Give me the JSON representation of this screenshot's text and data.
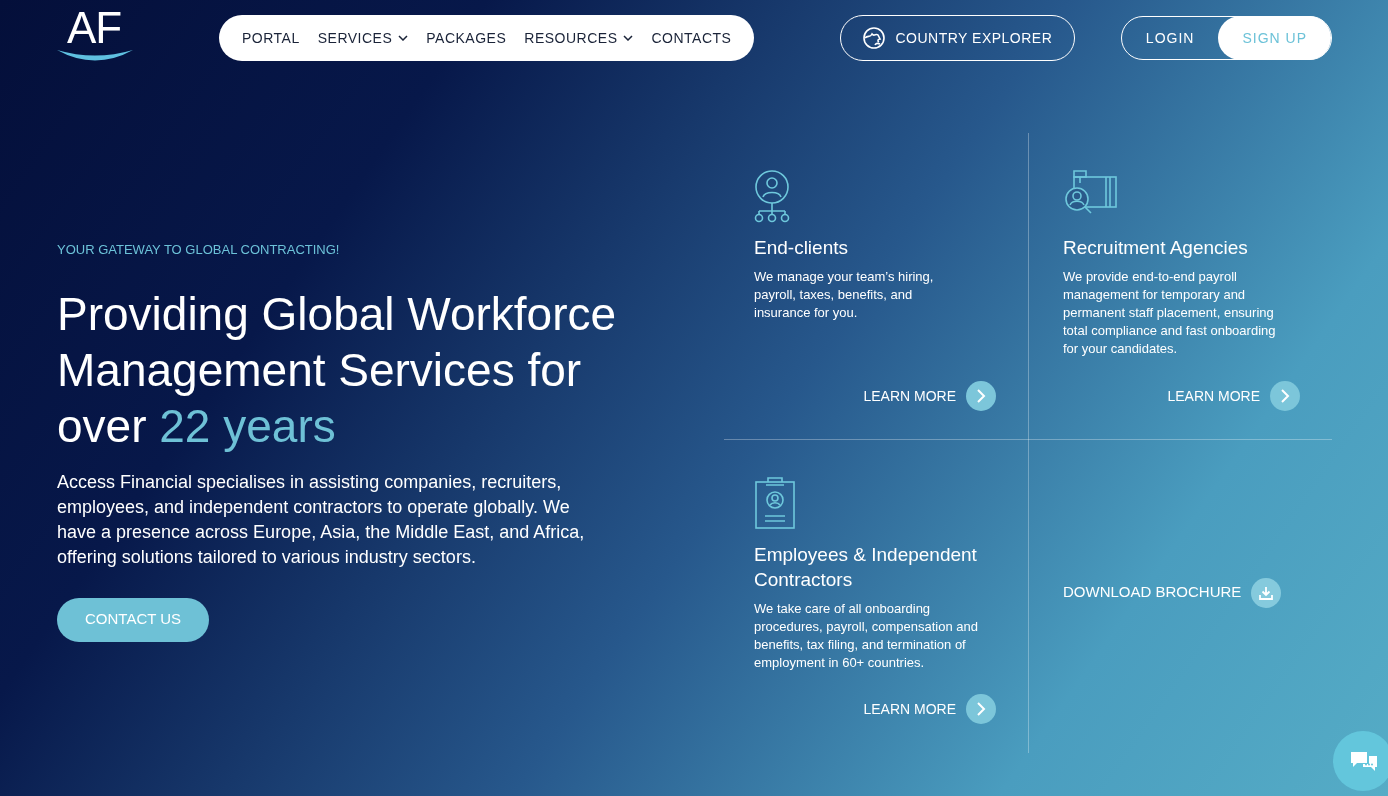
{
  "logo": {
    "text": "AF"
  },
  "nav": {
    "items": [
      {
        "label": "PORTAL",
        "dropdown": false
      },
      {
        "label": "SERVICES",
        "dropdown": true
      },
      {
        "label": "PACKAGES",
        "dropdown": false
      },
      {
        "label": "RESOURCES",
        "dropdown": true
      },
      {
        "label": "CONTACTS",
        "dropdown": false
      }
    ]
  },
  "country_explorer": {
    "label": "COUNTRY EXPLORER"
  },
  "auth": [
    {
      "label": "LOGIN",
      "selected": false
    },
    {
      "label": "SIGN UP",
      "selected": true
    }
  ],
  "hero": {
    "eyebrow": "YOUR GATEWAY TO GLOBAL CONTRACTING!",
    "title": "Providing Global Workforce Management Services for over",
    "highlight": "22 years",
    "description": "Access Financial specialises in assisting companies, recruiters, employees, and independent contractors to operate globally. We have a presence across Europe, Asia, the Middle East, and Africa, offering solutions tailored to various industry sectors.",
    "button": "CONTACT US"
  },
  "cards": [
    {
      "kind": "service",
      "title": "End-clients",
      "text": "We manage your team’s hiring, payroll, taxes, benefits, and insurance for you.",
      "link": "LEARN MORE"
    },
    {
      "kind": "service",
      "title": "Recruitment Agencies",
      "text": "We provide end-to-end payroll management for temporary and permanent staff placement, ensuring total compliance and fast onboarding for your candidates.",
      "link": "LEARN MORE"
    },
    {
      "kind": "service",
      "title": "Employees & Independent Contractors",
      "text": "We take care of all onboarding procedures, payroll, compensation and benefits, tax filing, and termination of employment in 60+ countries.",
      "link": "LEARN MORE"
    },
    {
      "kind": "download",
      "link": "DOWNLOAD BROCHURE"
    }
  ]
}
